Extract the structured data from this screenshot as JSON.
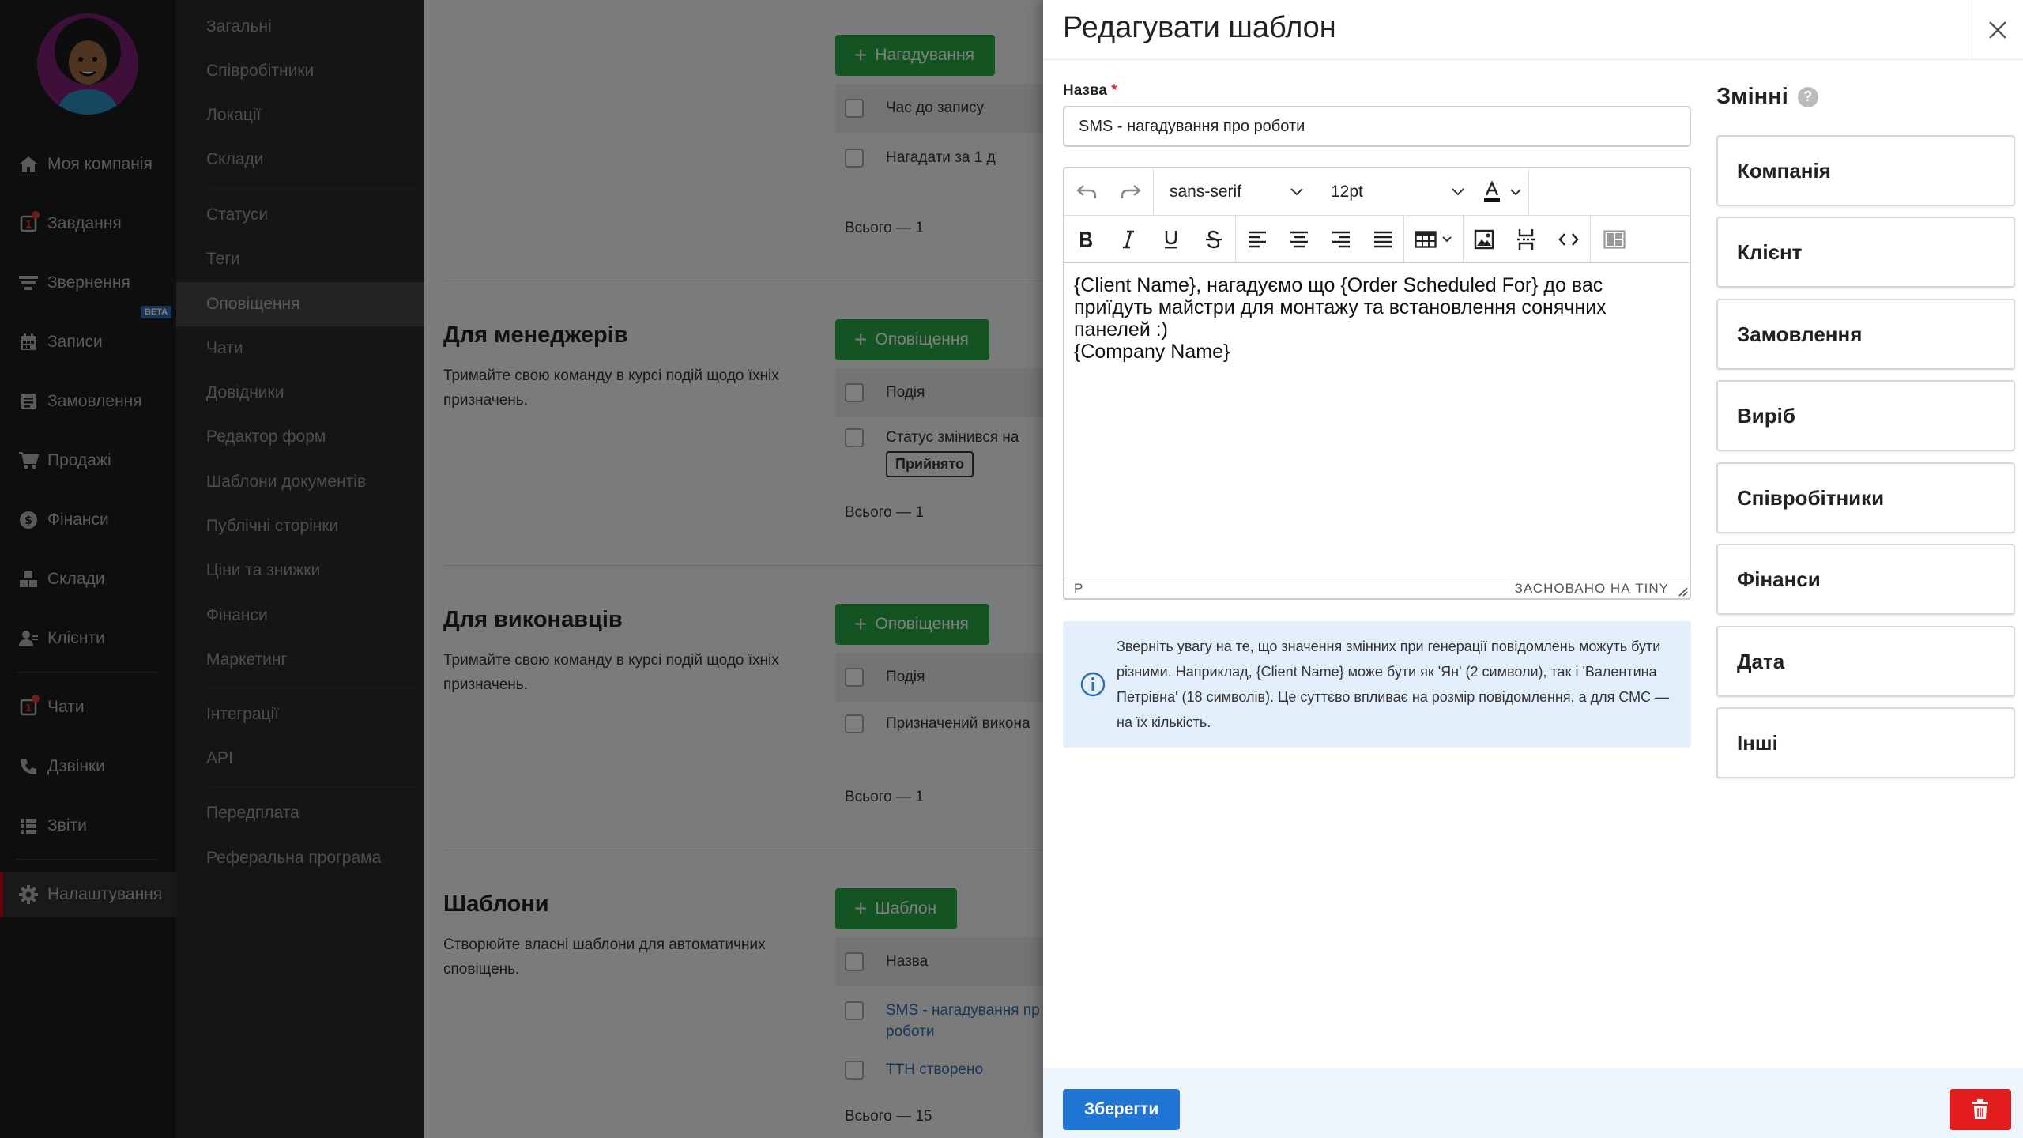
{
  "sidebar": {
    "items": [
      {
        "label": "Моя компанія",
        "icon": "home-icon"
      },
      {
        "label": "Завдання",
        "icon": "tasks-icon",
        "badge": "1"
      },
      {
        "label": "Звернення",
        "icon": "funnel-icon"
      },
      {
        "label": "Записи",
        "icon": "calendar-icon",
        "tag": "BETA"
      },
      {
        "label": "Замовлення",
        "icon": "orders-icon"
      },
      {
        "label": "Продажі",
        "icon": "cart-icon"
      },
      {
        "label": "Фінанси",
        "icon": "dollar-icon"
      },
      {
        "label": "Склади",
        "icon": "warehouse-icon"
      },
      {
        "label": "Клієнти",
        "icon": "clients-icon"
      },
      {
        "label": "Чати",
        "icon": "chat-icon",
        "badge": "1"
      },
      {
        "label": "Дзвінки",
        "icon": "phone-icon"
      },
      {
        "label": "Звіти",
        "icon": "reports-icon"
      },
      {
        "label": "Налаштування",
        "icon": "gear-icon"
      }
    ]
  },
  "submenu": {
    "items": [
      "Загальні",
      "Співробітники",
      "Локації",
      "Склади",
      "Статуси",
      "Теги",
      "Оповіщення",
      "Чати",
      "Довідники",
      "Редактор форм",
      "Шаблони документів",
      "Публічні сторінки",
      "Ціни та знижки",
      "Фінанси",
      "Маркетинг",
      "Інтеграції",
      "API",
      "Передплата",
      "Реферальна програма"
    ]
  },
  "content": {
    "reminders": {
      "button": "Нагадування",
      "header": "Час до запису",
      "row": "Нагадати за 1 д",
      "total": "Всього — 1"
    },
    "managers": {
      "title": "Для менеджерів",
      "desc": "Тримайте свою команду в курсі подій щодо їхніх призначень.",
      "button": "Оповіщення",
      "header": "Подія",
      "row": "Статус змінився на",
      "row_tag": "Прийнято",
      "total": "Всього — 1"
    },
    "executors": {
      "title": "Для виконавців",
      "desc": "Тримайте свою команду в курсі подій щодо їхніх призначень.",
      "button": "Оповіщення",
      "header": "Подія",
      "row": "Призначений викона",
      "total": "Всього — 1"
    },
    "templates": {
      "title": "Шаблони",
      "desc": "Створюйте власні шаблони для автоматичних сповіщень.",
      "button": "Шаблон",
      "header": "Назва",
      "rows": [
        "SMS - нагадування пр роботи",
        "ТТН створено"
      ],
      "total": "Всього — 15"
    }
  },
  "modal": {
    "title": "Редагувати шаблон",
    "name_label": "Назва",
    "name_required": "*",
    "name_value": "SMS - нагадування про роботи",
    "editor": {
      "font_family": "sans-serif",
      "font_size": "12pt",
      "body": [
        "{Client Name}, нагадуємо що {Order Scheduled For} до вас приїдуть майстри для монтажу та встановлення сонячних панелей :)",
        "{Company Name}"
      ],
      "status_path": "P",
      "status_brand": "ЗАСНОВАНО НА TINY"
    },
    "info": "Зверніть увагу на те, що значення змінних при генерації повідомлень можуть бути різними. Наприклад, {Client Name} може бути як 'Ян' (2 символи), так і 'Валентина Петрівна' (18 символів). Це суттєво впливає на розмір повідомлення, а для СМС — на їх кількість.",
    "variables_title": "Змінні",
    "variables_help": "?",
    "variables": [
      "Компанія",
      "Клієнт",
      "Замовлення",
      "Виріб",
      "Співробітники",
      "Фінанси",
      "Дата",
      "Інші"
    ],
    "save_label": "Зберегти"
  },
  "colors": {
    "accent_green": "#27a844",
    "accent_blue": "#1f74d4",
    "danger_red": "#e31d1d",
    "info_bg": "#e2eefa"
  }
}
